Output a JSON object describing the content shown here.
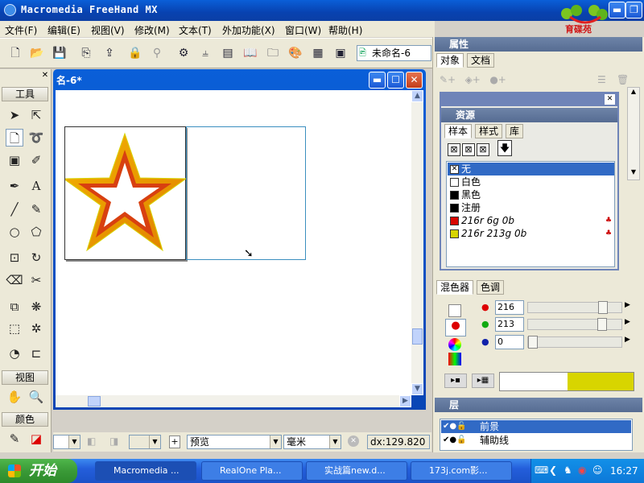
{
  "app": {
    "title": "Macromedia FreeHand MX",
    "logo_text": "育碟苑"
  },
  "menu": [
    "文件(F)",
    "编辑(E)",
    "视图(V)",
    "修改(M)",
    "文本(T)",
    "外加功能(X)",
    "窗口(W)",
    "帮助(H)"
  ],
  "toolbar": {
    "document_select": "未命名-6"
  },
  "tools_panel": {
    "title": "工具",
    "view_label": "视图",
    "color_label": "颜色"
  },
  "document": {
    "title": "名-6*"
  },
  "statusbar": {
    "preview": "预览",
    "units": "毫米",
    "readout": "dx:129.820"
  },
  "properties_panel": {
    "title": "属性",
    "tabs": [
      "对象",
      "文档"
    ]
  },
  "assets_panel": {
    "title": "资源",
    "tabs": [
      "样本",
      "样式",
      "库"
    ],
    "swatches": [
      {
        "name": "无",
        "color": "none",
        "selected": true
      },
      {
        "name": "白色",
        "color": "#ffffff"
      },
      {
        "name": "黑色",
        "color": "#000000"
      },
      {
        "name": "注册",
        "color": "#000000"
      },
      {
        "name": "216r 6g 0b",
        "color": "#d80600"
      },
      {
        "name": "216r 213g 0b",
        "color": "#d8d500"
      }
    ]
  },
  "mixer_panel": {
    "tabs": [
      "混色器",
      "色调"
    ],
    "red": {
      "value": "216",
      "fraction": 0.85
    },
    "green": {
      "value": "213",
      "fraction": 0.84
    },
    "blue": {
      "value": "0",
      "fraction": 0.0
    },
    "preview_color": "#d8d500"
  },
  "layers_panel": {
    "title": "层",
    "layers": [
      {
        "name": "前景",
        "selected": true
      },
      {
        "name": "辅助线",
        "selected": false
      }
    ]
  },
  "taskbar": {
    "start_label": "开始",
    "tasks": [
      "Macromedia ...",
      "RealOne Pla...",
      "实战篇new.d...",
      "173j.com影..."
    ],
    "clock": "16:27"
  }
}
